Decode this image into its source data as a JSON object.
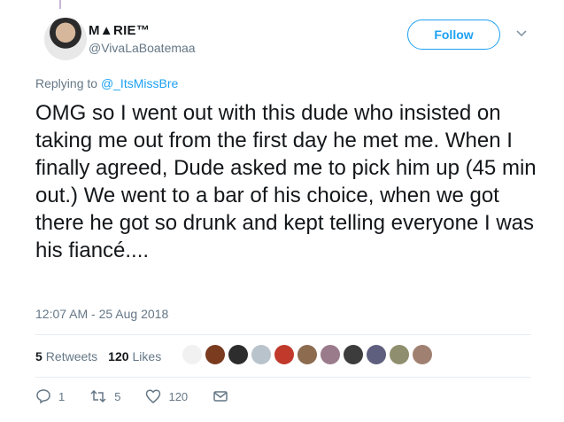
{
  "header": {
    "name": "M▲RIE™",
    "handle": "@VivaLaBoatemaa",
    "follow_label": "Follow"
  },
  "reply": {
    "prefix": "Replying to ",
    "mention": "@_ItsMissBre"
  },
  "tweet": {
    "text": "OMG so I went out with this dude who insisted on taking me out from the first day he met me. When I finally agreed, Dude asked me to pick him up (45 min out.) We went to a bar of his choice, when we got there he got so drunk and kept telling everyone I was his fiancé....",
    "timestamp": "12:07 AM - 25 Aug 2018"
  },
  "stats": {
    "retweets_count": "5",
    "retweets_label": "Retweets",
    "likes_count": "120",
    "likes_label": "Likes",
    "liker_colors": [
      "#f1f1f1",
      "#7a3b1f",
      "#2d2d2d",
      "#b8c3cc",
      "#c0392b",
      "#8c6b4f",
      "#9a7b8c",
      "#3c3c3c",
      "#5e5e7e",
      "#8f8f6f",
      "#a08070"
    ]
  },
  "actions": {
    "reply_count": "1",
    "retweet_count": "5",
    "like_count": "120"
  },
  "icons": [
    "chevron-down-icon",
    "reply-icon",
    "retweet-icon",
    "heart-icon",
    "message-icon"
  ]
}
